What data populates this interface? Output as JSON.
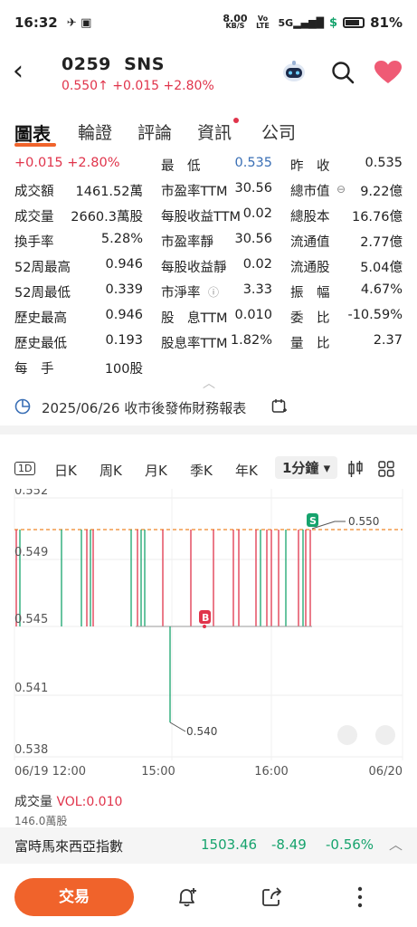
{
  "status_bar": {
    "time": "16:32",
    "net_speed": "8.00",
    "net_unit": "KB/S",
    "volte": "Vo LTE",
    "signal": "5G",
    "battery": "81%"
  },
  "header": {
    "code": "0259",
    "name": "SNS",
    "price": "0.550",
    "change": "+0.015",
    "change_pct": "+2.80%"
  },
  "tabs": [
    "圖表",
    "輪證",
    "評論",
    "資訊",
    "公司"
  ],
  "stats": {
    "rows": [
      [
        {
          "l": "+0.015 +2.80%",
          "v": "",
          "c": "red"
        },
        {
          "l": "最　低",
          "v": "0.535",
          "c": "blue"
        },
        {
          "l": "昨　收",
          "v": "0.535"
        }
      ],
      [
        {
          "l": "成交額",
          "v": "1461.52萬"
        },
        {
          "l": "市盈率TTM",
          "v": "30.56"
        },
        {
          "l": "總市值",
          "v": "9.22億"
        }
      ],
      [
        {
          "l": "成交量",
          "v": "2660.3萬股"
        },
        {
          "l": "每股收益TTM",
          "v": "0.02"
        },
        {
          "l": "總股本",
          "v": "16.76億"
        }
      ],
      [
        {
          "l": "換手率",
          "v": "5.28%"
        },
        {
          "l": "市盈率靜",
          "v": "30.56"
        },
        {
          "l": "流通值",
          "v": "2.77億"
        }
      ],
      [
        {
          "l": "52周最高",
          "v": "0.946"
        },
        {
          "l": "每股收益靜",
          "v": "0.02"
        },
        {
          "l": "流通股",
          "v": "5.04億"
        }
      ],
      [
        {
          "l": "52周最低",
          "v": "0.339"
        },
        {
          "l": "市淨率",
          "v": "3.33"
        },
        {
          "l": "振　幅",
          "v": "4.67%"
        }
      ],
      [
        {
          "l": "歷史最高",
          "v": "0.946"
        },
        {
          "l": "股　息TTM",
          "v": "0.010"
        },
        {
          "l": "委　比",
          "v": "-10.59%"
        }
      ],
      [
        {
          "l": "歷史最低",
          "v": "0.193"
        },
        {
          "l": "股息率TTM",
          "v": "1.82%"
        },
        {
          "l": "量　比",
          "v": "2.37"
        }
      ],
      [
        {
          "l": "每　手",
          "v": "100股"
        }
      ]
    ]
  },
  "notice": "2025/06/26 收市後發佈財務報表",
  "ktabs": [
    "1D",
    "日K",
    "周K",
    "月K",
    "季K",
    "年K",
    "1分鐘 ▾"
  ],
  "chart_data": {
    "type": "line",
    "y_ticks": [
      "0.552",
      "0.549",
      "0.545",
      "0.541",
      "0.538"
    ],
    "x_ticks": [
      "06/19 12:00",
      "15:00",
      "16:00",
      "06/20"
    ],
    "prev_close_label": "0.550",
    "low_label": "0.540",
    "markers": [
      "B",
      "S"
    ],
    "ylim": [
      0.538,
      0.552
    ]
  },
  "volume": {
    "label": "成交量",
    "value": "VOL:0.010",
    "max": "146.0萬股"
  },
  "ticker": {
    "name": "富時馬來西亞指數",
    "price": "1503.46",
    "change": "-8.49",
    "pct": "-0.56%"
  },
  "bottom": {
    "trade": "交易"
  }
}
